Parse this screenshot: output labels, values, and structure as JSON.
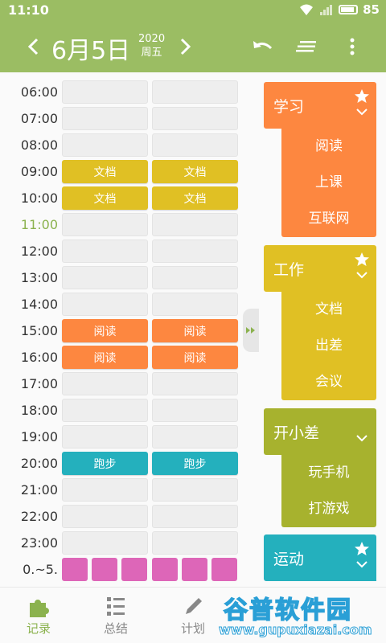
{
  "status_bar": {
    "time": "11:10",
    "battery": "85"
  },
  "header": {
    "date": "6月5日",
    "year": "2020",
    "weekday": "周五",
    "icons": [
      "chevron-left-icon",
      "chevron-right-icon",
      "undo-icon",
      "list-icon",
      "more-vertical-icon"
    ]
  },
  "colors": {
    "header_bg": "#9bbd63",
    "study": "#fd8740",
    "work": "#e0c024",
    "slack": "#a7b22e",
    "sport": "#24b0bd",
    "reading": "#fd8740",
    "document": "#e0c024",
    "running": "#24b0bd",
    "sleep": "#dd66b8",
    "current_hour": "#8bb24e"
  },
  "schedule": {
    "rows": [
      {
        "time": "06:00",
        "slots": [
          "",
          ""
        ]
      },
      {
        "time": "07:00",
        "slots": [
          "",
          ""
        ]
      },
      {
        "time": "08:00",
        "slots": [
          "",
          ""
        ]
      },
      {
        "time": "09:00",
        "slots": [
          "文档",
          "文档"
        ]
      },
      {
        "time": "10:00",
        "slots": [
          "文档",
          "文档"
        ]
      },
      {
        "time": "11:00",
        "slots": [
          "",
          ""
        ],
        "current": true
      },
      {
        "time": "12:00",
        "slots": [
          "",
          ""
        ]
      },
      {
        "time": "13:00",
        "slots": [
          "",
          ""
        ]
      },
      {
        "time": "14:00",
        "slots": [
          "",
          ""
        ]
      },
      {
        "time": "15:00",
        "slots": [
          "阅读",
          "阅读"
        ]
      },
      {
        "time": "16:00",
        "slots": [
          "阅读",
          "阅读"
        ]
      },
      {
        "time": "17:00",
        "slots": [
          "",
          ""
        ]
      },
      {
        "time": "18:00",
        "slots": [
          "",
          ""
        ]
      },
      {
        "time": "19:00",
        "slots": [
          "",
          ""
        ]
      },
      {
        "time": "20:00",
        "slots": [
          "跑步",
          "跑步"
        ]
      },
      {
        "time": "21:00",
        "slots": [
          "",
          ""
        ]
      },
      {
        "time": "22:00",
        "slots": [
          "",
          ""
        ]
      },
      {
        "time": "23:00",
        "slots": [
          "",
          ""
        ]
      }
    ],
    "last_row_label": "0.~5."
  },
  "categories": [
    {
      "title": "学习",
      "starred": true,
      "color": "#fd8740",
      "items": [
        "阅读",
        "上课",
        "互联网"
      ]
    },
    {
      "title": "工作",
      "starred": true,
      "color": "#e0c024",
      "items": [
        "文档",
        "出差",
        "会议"
      ]
    },
    {
      "title": "开小差",
      "starred": false,
      "color": "#a7b22e",
      "items": [
        "玩手机",
        "打游戏"
      ]
    },
    {
      "title": "运动",
      "starred": true,
      "color": "#24b0bd",
      "items": []
    }
  ],
  "bottom_nav": [
    {
      "label": "记录",
      "icon": "puzzle-icon",
      "active": true
    },
    {
      "label": "总结",
      "icon": "list-icon",
      "active": false
    },
    {
      "label": "计划",
      "icon": "pencil-icon",
      "active": false
    }
  ],
  "watermark": {
    "title": "谷普软件园",
    "url": "www.gupuxiazai.com"
  }
}
